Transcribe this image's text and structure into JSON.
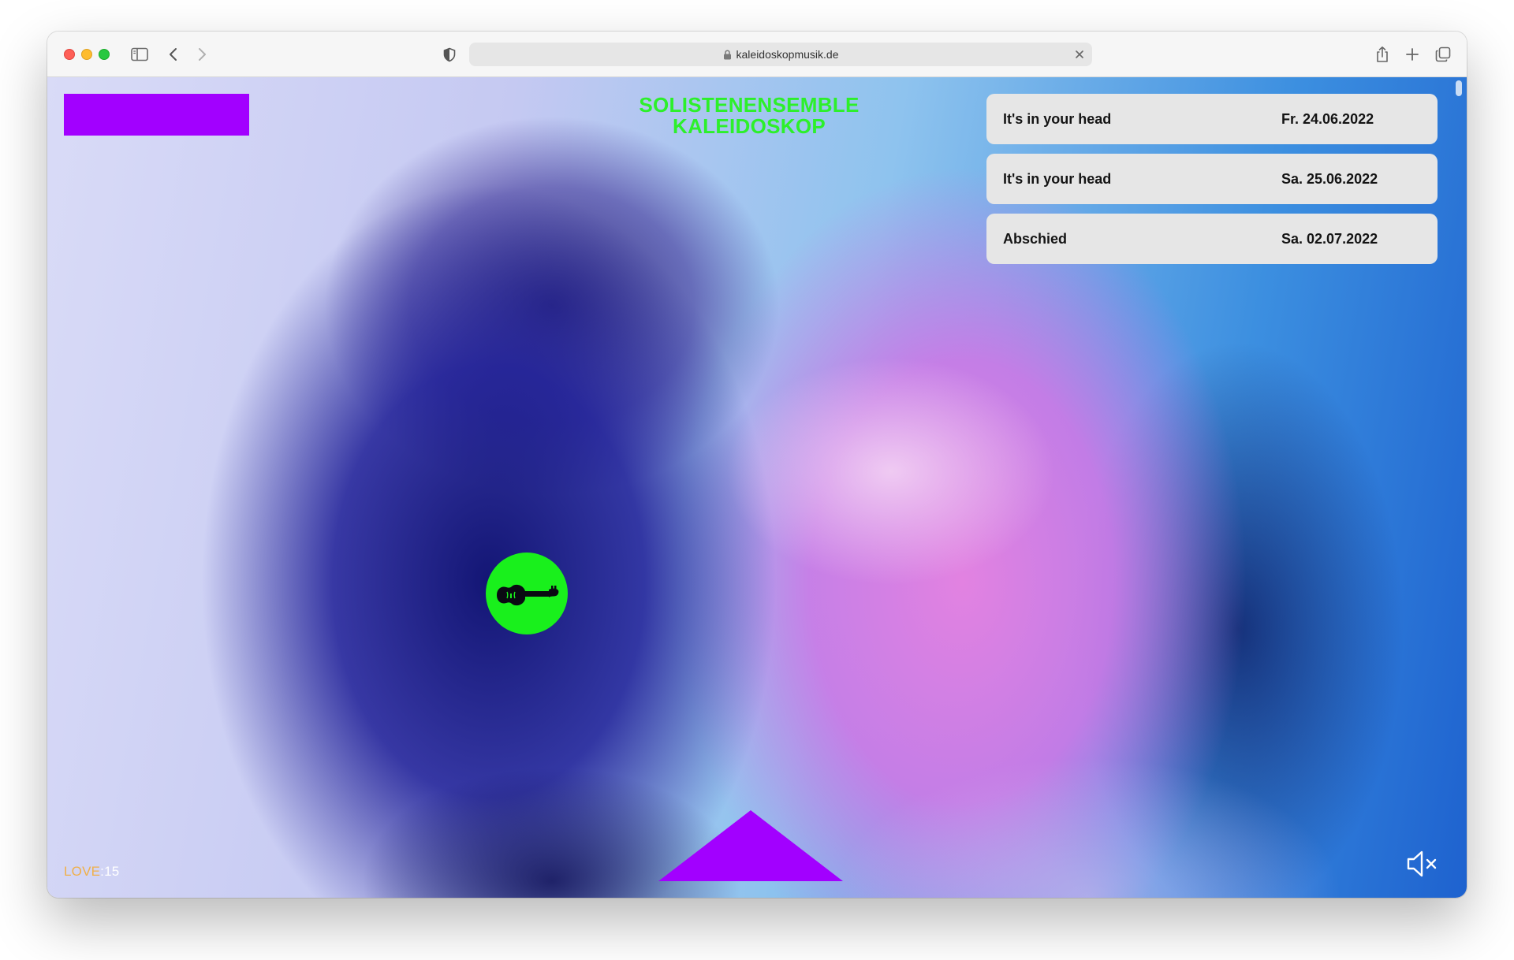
{
  "browser": {
    "url": "kaleidoskopmusik.de",
    "icons": {
      "sidebar": "sidebar-icon",
      "back": "chevron-left-icon",
      "forward": "chevron-right-icon",
      "privacy": "shield-icon",
      "lock": "lock-icon",
      "clear": "close-icon",
      "share": "share-icon",
      "new_tab": "plus-icon",
      "tabs": "tabs-overview-icon"
    }
  },
  "page": {
    "title_line1": "SOLISTENENSEMBLE",
    "title_line2": "KALEIDOSKOP",
    "colors": {
      "accent_purple": "#a200ff",
      "accent_green": "#19f01c",
      "title_green": "#2cf02a",
      "card_bg": "#e6e6e6"
    },
    "events": [
      {
        "name": "It's in your head",
        "date": "Fr. 24.06.2022"
      },
      {
        "name": "It's in your head",
        "date": "Sa. 25.06.2022"
      },
      {
        "name": "Abschied",
        "date": "Sa. 02.07.2022"
      }
    ],
    "love": {
      "label": "LOVE",
      "separator": ":",
      "count": "15"
    },
    "icons": {
      "violin": "violin-icon",
      "up_arrow": "triangle-up-icon",
      "mute": "speaker-muted-icon"
    }
  }
}
